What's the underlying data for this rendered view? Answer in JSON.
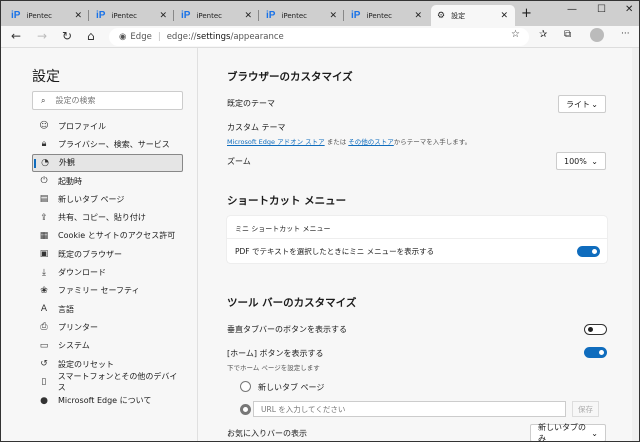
{
  "tabs": [
    {
      "title": "iPentec"
    },
    {
      "title": "iPentec"
    },
    {
      "title": "iPentec"
    },
    {
      "title": "iPentec"
    },
    {
      "title": "iPentec"
    },
    {
      "title": "設定",
      "active": true
    }
  ],
  "address": {
    "site": "Edge",
    "url_prefix": "edge://",
    "url_bold": "settings",
    "url_suffix": "/appearance"
  },
  "sidebar": {
    "title": "設定",
    "search_placeholder": "設定の検索",
    "items": [
      {
        "label": "プロファイル",
        "icon": "profile-icon"
      },
      {
        "label": "プライバシー、検索、サービス",
        "icon": "lock-icon"
      },
      {
        "label": "外観",
        "icon": "palette-icon",
        "selected": true
      },
      {
        "label": "起動時",
        "icon": "power-icon"
      },
      {
        "label": "新しいタブ ページ",
        "icon": "newtab-icon"
      },
      {
        "label": "共有、コピー、貼り付け",
        "icon": "share-icon"
      },
      {
        "label": "Cookie とサイトのアクセス許可",
        "icon": "cookie-icon"
      },
      {
        "label": "既定のブラウザー",
        "icon": "browser-icon"
      },
      {
        "label": "ダウンロード",
        "icon": "download-icon"
      },
      {
        "label": "ファミリー セーフティ",
        "icon": "family-icon"
      },
      {
        "label": "言語",
        "icon": "language-icon"
      },
      {
        "label": "プリンター",
        "icon": "printer-icon"
      },
      {
        "label": "システム",
        "icon": "laptop-icon"
      },
      {
        "label": "設定のリセット",
        "icon": "reset-icon"
      },
      {
        "label": "スマートフォンとその他のデバイス",
        "icon": "phone-icon"
      },
      {
        "label": "Microsoft Edge について",
        "icon": "edge-icon"
      }
    ]
  },
  "main": {
    "browser_section": {
      "title": "ブラウザーのカスタマイズ",
      "theme_label": "既定のテーマ",
      "theme_value": "ライト",
      "custom_theme_label": "カスタム テーマ",
      "link1": "Microsoft Edge アドオン ストア",
      "or_text": "または",
      "link2": "その他のストア",
      "suffix_text": "からテーマを入手します。",
      "zoom_label": "ズーム",
      "zoom_value": "100%"
    },
    "shortcut_section": {
      "title": "ショートカット メニュー",
      "card_title": "ミニ ショートカット メニュー",
      "pdf_label": "PDF でテキストを選択したときにミニ メニューを表示する",
      "pdf_on": true
    },
    "toolbar_section": {
      "title": "ツール バーのカスタマイズ",
      "vertical_tabs_label": "垂直タブバーのボタンを表示する",
      "vertical_tabs_on": false,
      "home_label": "[ホーム] ボタンを表示する",
      "home_on": true,
      "home_sub": "下でホーム ページを設定します",
      "radio_newtab": "新しいタブ ページ",
      "url_placeholder": "URL を入力してください",
      "save_label": "保存",
      "favorites_label": "お気に入りバーの表示",
      "favorites_value": "新しいタブのみ"
    }
  }
}
